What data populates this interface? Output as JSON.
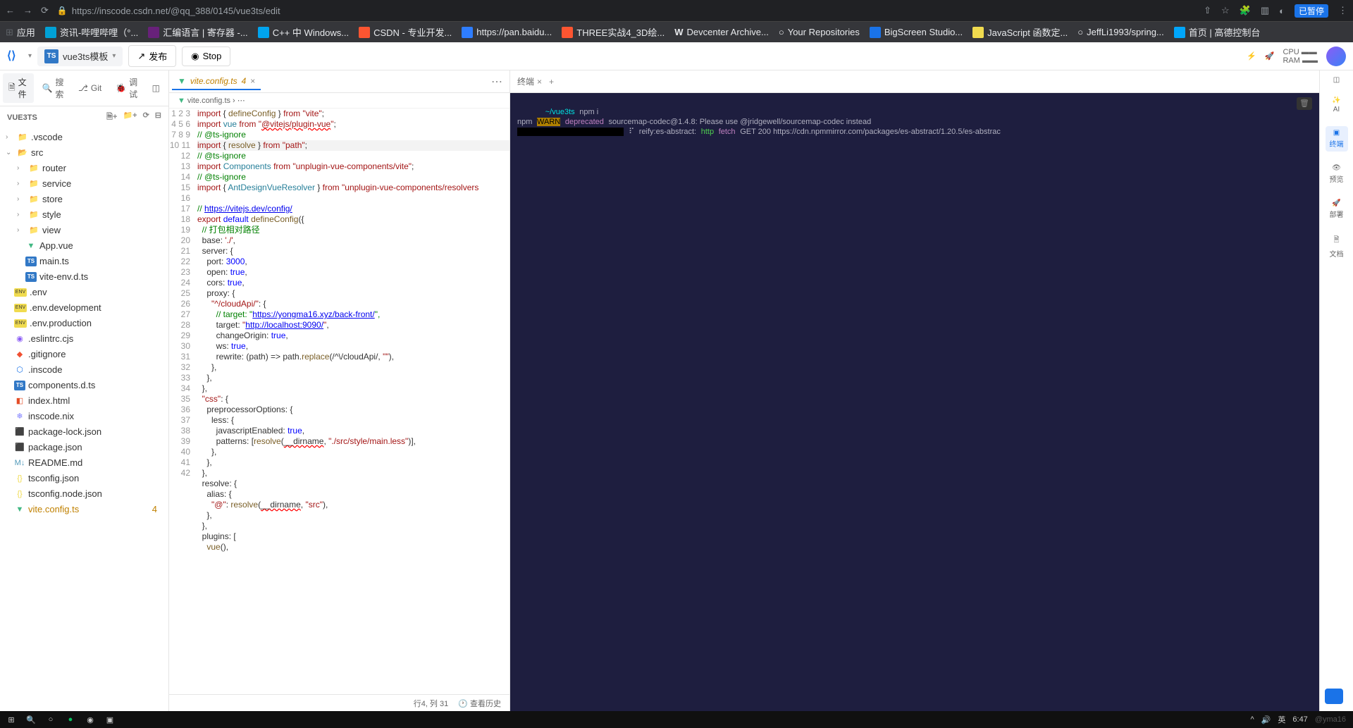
{
  "browser": {
    "url": "https://inscode.csdn.net/@qq_388/0145/vue3ts/edit",
    "paused": "已暂停"
  },
  "bookmarks": [
    {
      "label": "应用",
      "color": "#5f6368"
    },
    {
      "label": "资讯-哔哩哔哩（°...",
      "color": "#00a1d6"
    },
    {
      "label": "汇编语言 | 寄存器 -...",
      "color": "#68217a"
    },
    {
      "label": "C++ 中 Windows...",
      "color": "#00a4ef"
    },
    {
      "label": "CSDN - 专业开发...",
      "color": "#fc5531"
    },
    {
      "label": "https://pan.baidu...",
      "color": "#2e7dff"
    },
    {
      "label": "THREE实战4_3D绘...",
      "color": "#fc5531"
    },
    {
      "label": "Devcenter Archive...",
      "color": "#fff"
    },
    {
      "label": "Your Repositories",
      "color": "#fff"
    },
    {
      "label": "BigScreen Studio...",
      "color": "#1a73e8"
    },
    {
      "label": "JavaScript 函数定...",
      "color": "#f0db4f"
    },
    {
      "label": "JeffLi1993/spring...",
      "color": "#fff"
    },
    {
      "label": "首页 | 高德控制台",
      "color": "#00a6fb"
    }
  ],
  "inscode": {
    "project": "vue3ts模板",
    "publish": "发布",
    "stop": "Stop",
    "cpu": "CPU",
    "ram": "RAM"
  },
  "sidebar": {
    "tab_file": "文件",
    "tab_search": "搜索",
    "tab_git": "Git",
    "tab_debug": "调试",
    "root": "VUE3TS",
    "tree": {
      "vscode": ".vscode",
      "src": "src",
      "router": "router",
      "service": "service",
      "store": "store",
      "style": "style",
      "view": "view",
      "app_vue": "App.vue",
      "main_ts": "main.ts",
      "vite_env": "vite-env.d.ts",
      "env": ".env",
      "env_dev": ".env.development",
      "env_prod": ".env.production",
      "eslint": ".eslintrc.cjs",
      "gitignore": ".gitignore",
      "inscode": ".inscode",
      "components_dts": "components.d.ts",
      "index_html": "index.html",
      "inscode_nix": "inscode.nix",
      "pkg_lock": "package-lock.json",
      "pkg_json": "package.json",
      "readme": "README.md",
      "tsconfig": "tsconfig.json",
      "tsconfig_node": "tsconfig.node.json",
      "vite_config": "vite.config.ts",
      "vite_badge": "4"
    }
  },
  "editor": {
    "tab_name": "vite.config.ts",
    "tab_badge": "4",
    "breadcrumb": "vite.config.ts",
    "lines": 42,
    "cursor": "行4, 列 31",
    "history": "查看历史"
  },
  "terminal": {
    "tab": "终端",
    "cwd": "~/vue3ts",
    "cmd": "npm i",
    "line2_a": "npm",
    "line2_b": "WARN",
    "line2_c": "deprecated",
    "line2_d": "sourcemap-codec@1.4.8: Please use @jridgewell/sourcemap-codec instead",
    "line3_a": "⸨░░░░░░░░░░░░░░░░░░⸩",
    "line3_b": "reify:es-abstract:",
    "line3_c": "http",
    "line3_d": "fetch",
    "line3_e": "GET 200 https://cdn.npmmirror.com/packages/es-abstract/1.20.5/es-abstrac"
  },
  "rail": {
    "ai": "AI",
    "terminal": "终端",
    "preview": "预览",
    "deploy": "部署",
    "docs": "文档"
  },
  "taskbar": {
    "time": "6:47",
    "ime": "英",
    "date_suffix": "@yma16"
  }
}
